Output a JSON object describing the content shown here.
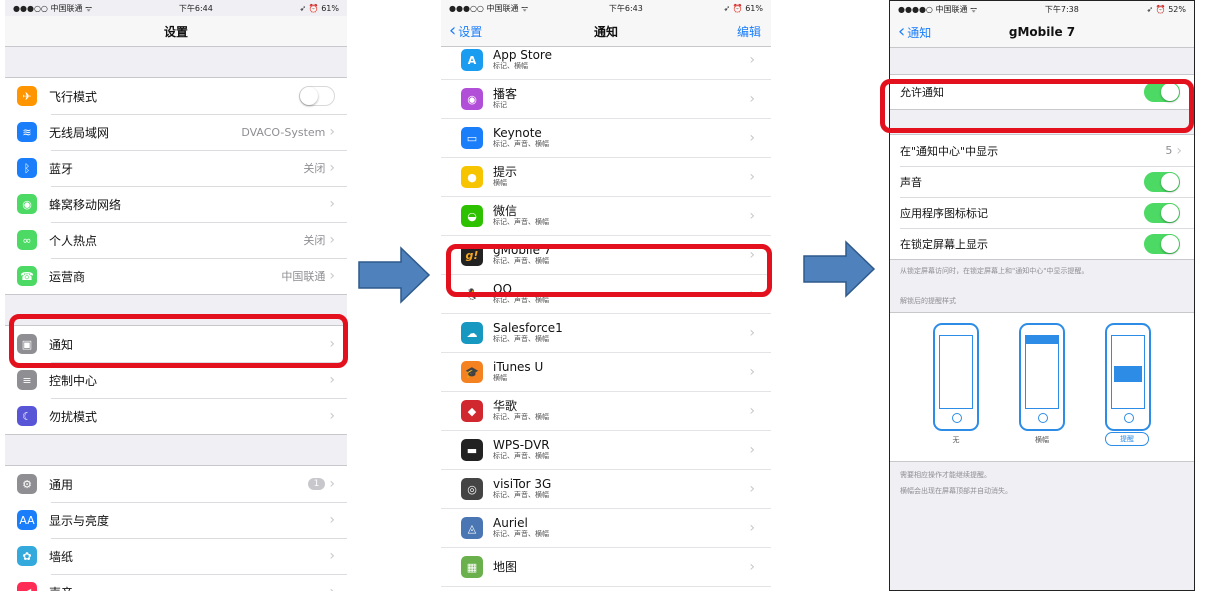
{
  "colors": {
    "accent": "#1a7efb",
    "toggle_on": "#4cd964",
    "highlight": "#e3101d",
    "arrow": "#4f81bd"
  },
  "phone1": {
    "status": {
      "carrier": "●●●○○ 中国联通 ᯤ",
      "time": "下午6:44",
      "battery": "➶ ⏰ 61%"
    },
    "title": "设置",
    "group1": [
      {
        "label": "飞行模式",
        "value": "",
        "icon": "airplane-icon",
        "color": "#ff9500"
      },
      {
        "label": "无线局域网",
        "value": "DVACO-System",
        "icon": "wifi-icon",
        "color": "#1a7efb"
      },
      {
        "label": "蓝牙",
        "value": "关闭",
        "icon": "bluetooth-icon",
        "color": "#1a7efb"
      },
      {
        "label": "蜂窝移动网络",
        "value": "",
        "icon": "cellular-icon",
        "color": "#4cd964"
      },
      {
        "label": "个人热点",
        "value": "关闭",
        "icon": "hotspot-icon",
        "color": "#4cd964"
      },
      {
        "label": "运营商",
        "value": "中国联通",
        "icon": "phone-icon",
        "color": "#4cd964"
      }
    ],
    "group2": [
      {
        "label": "通知",
        "icon": "notification-icon",
        "color": "#8e8e93"
      },
      {
        "label": "控制中心",
        "icon": "control-center-icon",
        "color": "#8e8e93"
      },
      {
        "label": "勿扰模式",
        "icon": "moon-icon",
        "color": "#5856d6"
      }
    ],
    "group3": [
      {
        "label": "通用",
        "badge": "1",
        "icon": "gear-icon",
        "color": "#8e8e93"
      },
      {
        "label": "显示与亮度",
        "icon": "display-icon",
        "color": "#1a7efb"
      },
      {
        "label": "墙纸",
        "icon": "wallpaper-icon",
        "color": "#34aadc"
      },
      {
        "label": "声音",
        "icon": "sound-icon",
        "color": "#ff2d55"
      }
    ]
  },
  "phone2": {
    "status": {
      "carrier": "●●●○○ 中国联通 ᯤ",
      "time": "下午6:43",
      "battery": "➶ ⏰ 61%"
    },
    "back": "设置",
    "title": "通知",
    "edit": "编辑",
    "apps": [
      {
        "name": "App Store",
        "sub": "标记、横幅",
        "icon": "app-store-icon",
        "color": "#1a9cf0",
        "glyph": "A"
      },
      {
        "name": "播客",
        "sub": "标记",
        "icon": "podcasts-icon",
        "color": "#b24fd8",
        "glyph": "◉"
      },
      {
        "name": "Keynote",
        "sub": "标记、声音、横幅",
        "icon": "keynote-icon",
        "color": "#1a7efb",
        "glyph": "▭"
      },
      {
        "name": "提示",
        "sub": "横幅",
        "icon": "tips-icon",
        "color": "#f7c400",
        "glyph": "●"
      },
      {
        "name": "微信",
        "sub": "标记、声音、横幅",
        "icon": "wechat-icon",
        "color": "#2dc100",
        "glyph": "◒"
      },
      {
        "name": "gMobile 7",
        "sub": "标记、声音、横幅",
        "icon": "gmobile-icon",
        "color": "#222222",
        "glyph": "g!"
      },
      {
        "name": "QQ",
        "sub": "标记、声音、横幅",
        "icon": "qq-icon",
        "color": "#ffffff",
        "glyph": "🐧"
      },
      {
        "name": "Salesforce1",
        "sub": "标记、声音、横幅",
        "icon": "salesforce-icon",
        "color": "#1798c1",
        "glyph": "☁"
      },
      {
        "name": "iTunes U",
        "sub": "横幅",
        "icon": "itunes-u-icon",
        "color": "#f58220",
        "glyph": "🎓"
      },
      {
        "name": "华歌",
        "sub": "标记、声音、横幅",
        "icon": "huage-icon",
        "color": "#d0282e",
        "glyph": "◆"
      },
      {
        "name": "WPS-DVR",
        "sub": "标记、声音、横幅",
        "icon": "wps-dvr-icon",
        "color": "#222222",
        "glyph": "▬"
      },
      {
        "name": "visiTor 3G",
        "sub": "标记、声音、横幅",
        "icon": "visitor-icon",
        "color": "#444444",
        "glyph": "◎"
      },
      {
        "name": "Auriel",
        "sub": "标记、声音、横幅",
        "icon": "auriel-icon",
        "color": "#4a77b4",
        "glyph": "◬"
      },
      {
        "name": "地图",
        "sub": "",
        "icon": "maps-icon",
        "color": "#6ab04c",
        "glyph": "▦"
      }
    ]
  },
  "phone3": {
    "status": {
      "carrier": "●●●●○ 中国联通 ᯤ",
      "time": "下午7:38",
      "battery": "➶ ⏰ 52%"
    },
    "back": "通知",
    "title": "gMobile 7",
    "allow": "允许通知",
    "rows": [
      {
        "label": "在\"通知中心\"中显示",
        "value": "5",
        "type": "value"
      },
      {
        "label": "声音",
        "type": "toggle"
      },
      {
        "label": "应用程序图标标记",
        "type": "toggle"
      },
      {
        "label": "在锁定屏幕上显示",
        "type": "toggle"
      }
    ],
    "lock_note": "从锁定屏幕访问时，在锁定屏幕上和\"通知中心\"中显示提醒。",
    "style_header": "解锁后的提醒样式",
    "styles": [
      {
        "label": "无",
        "style": "none"
      },
      {
        "label": "横幅",
        "style": "banner"
      },
      {
        "label": "提醒",
        "style": "alert"
      }
    ],
    "footer_note_1": "需要相应操作才能继续提醒。",
    "footer_note_2": "横幅会出现在屏幕顶部并自动消失。"
  }
}
